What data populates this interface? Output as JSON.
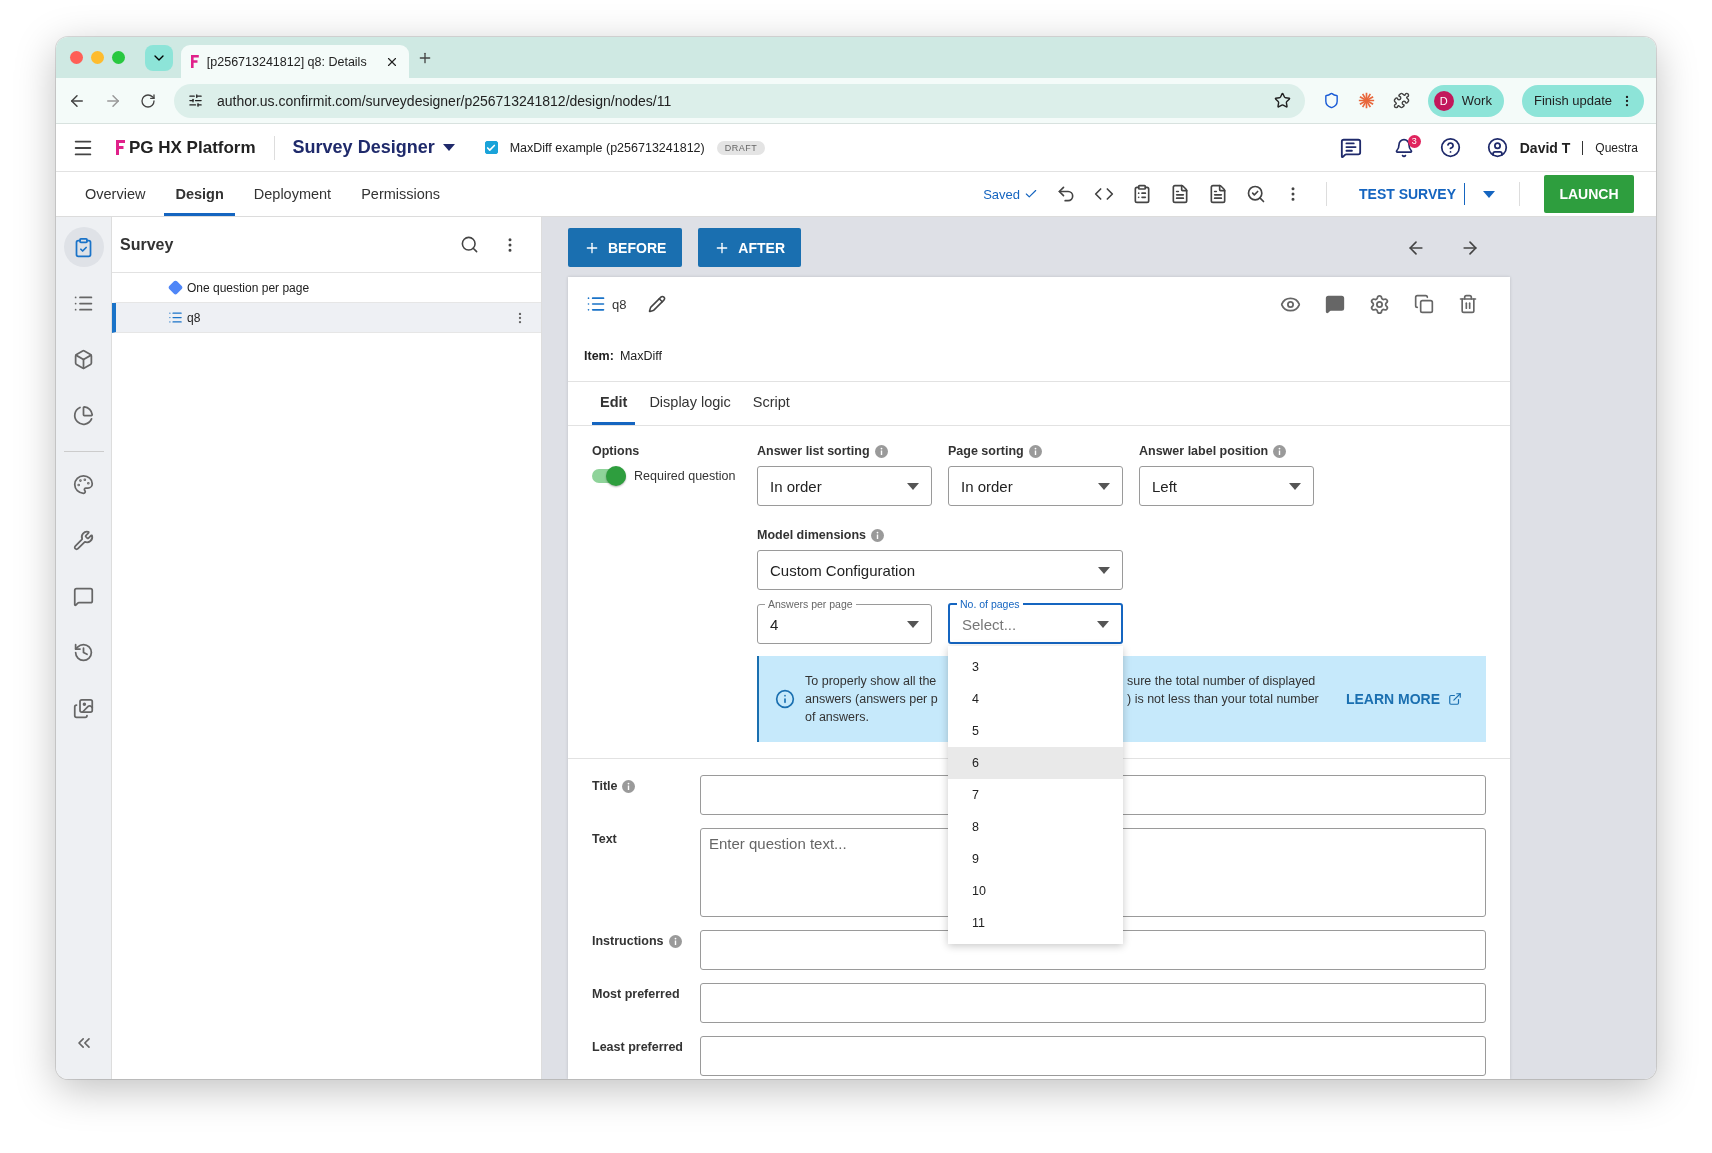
{
  "browser": {
    "tab_title": "[p256713241812] q8: Details",
    "url": "author.us.confirmit.com/surveydesigner/p256713241812/design/nodes/11",
    "profile": {
      "initial": "D",
      "label": "Work"
    },
    "update_button": "Finish update"
  },
  "app_header": {
    "brand": "PG HX Platform",
    "product": "Survey Designer",
    "survey": {
      "name": "MaxDiff example (p256713241812)",
      "checked": true
    },
    "status_badge": "DRAFT",
    "notifications": "3",
    "user": "David T",
    "org": "Questra"
  },
  "nav_tabs": [
    {
      "label": "Overview",
      "selected": false
    },
    {
      "label": "Design",
      "selected": true
    },
    {
      "label": "Deployment",
      "selected": false
    },
    {
      "label": "Permissions",
      "selected": false
    }
  ],
  "toolbar": {
    "saved": "Saved",
    "test_button": "TEST SURVEY",
    "launch_button": "LAUNCH"
  },
  "rail": [
    {
      "kind": "survey",
      "selected": true
    },
    {
      "kind": "list",
      "selected": false
    },
    {
      "kind": "cube",
      "selected": false
    },
    {
      "kind": "chart",
      "selected": false
    },
    {
      "kind": "palette",
      "selected": false
    },
    {
      "kind": "wrench",
      "selected": false
    },
    {
      "kind": "comment",
      "selected": false
    },
    {
      "kind": "history",
      "selected": false
    },
    {
      "kind": "images",
      "selected": false
    }
  ],
  "panel": {
    "title": "Survey",
    "tree": [
      {
        "kind": "rule",
        "label": "One question per page",
        "selected": false
      },
      {
        "kind": "question",
        "label": "q8",
        "selected": true
      }
    ]
  },
  "actions": {
    "before": "BEFORE",
    "after": "AFTER"
  },
  "question": {
    "name": "q8",
    "item_label": "Item:",
    "item_value": "MaxDiff",
    "tabs": [
      {
        "label": "Edit",
        "selected": true
      },
      {
        "label": "Display logic",
        "selected": false
      },
      {
        "label": "Script",
        "selected": false
      }
    ],
    "options_label": "Options",
    "required": {
      "label": "Required question",
      "on": true
    },
    "selects": [
      {
        "label": "Answer list sorting",
        "value": "In order"
      },
      {
        "label": "Page sorting",
        "value": "In order"
      },
      {
        "label": "Answer label position",
        "value": "Left"
      }
    ],
    "model": {
      "label": "Model dimensions",
      "value": "Custom Configuration"
    },
    "answers_per_page": {
      "label": "Answers per page",
      "value": "4"
    },
    "pages": {
      "label": "No. of pages",
      "placeholder": "Select...",
      "expanded": true,
      "options": [
        {
          "label": "3",
          "highlighted": false
        },
        {
          "label": "4",
          "highlighted": false
        },
        {
          "label": "5",
          "highlighted": false
        },
        {
          "label": "6",
          "highlighted": true
        },
        {
          "label": "7",
          "highlighted": false
        },
        {
          "label": "8",
          "highlighted": false
        },
        {
          "label": "9",
          "highlighted": false
        },
        {
          "label": "10",
          "highlighted": false
        },
        {
          "label": "11",
          "highlighted": false
        }
      ]
    },
    "info": {
      "lines": [
        {
          "left": "To properly show all the",
          "right": "sure the total number of displayed"
        },
        {
          "left": "answers (answers per p",
          "right": ") is not less than your total number"
        },
        {
          "left": "of answers."
        }
      ],
      "link": "LEARN MORE"
    },
    "fields": [
      {
        "label": "Title",
        "info": true,
        "kind": "input"
      },
      {
        "label": "Text",
        "info": false,
        "kind": "textarea",
        "placeholder": "Enter question text..."
      },
      {
        "label": "Instructions",
        "info": true,
        "kind": "input"
      },
      {
        "label": "Most preferred",
        "info": false,
        "kind": "input"
      },
      {
        "label": "Least preferred",
        "info": false,
        "kind": "input"
      }
    ]
  }
}
